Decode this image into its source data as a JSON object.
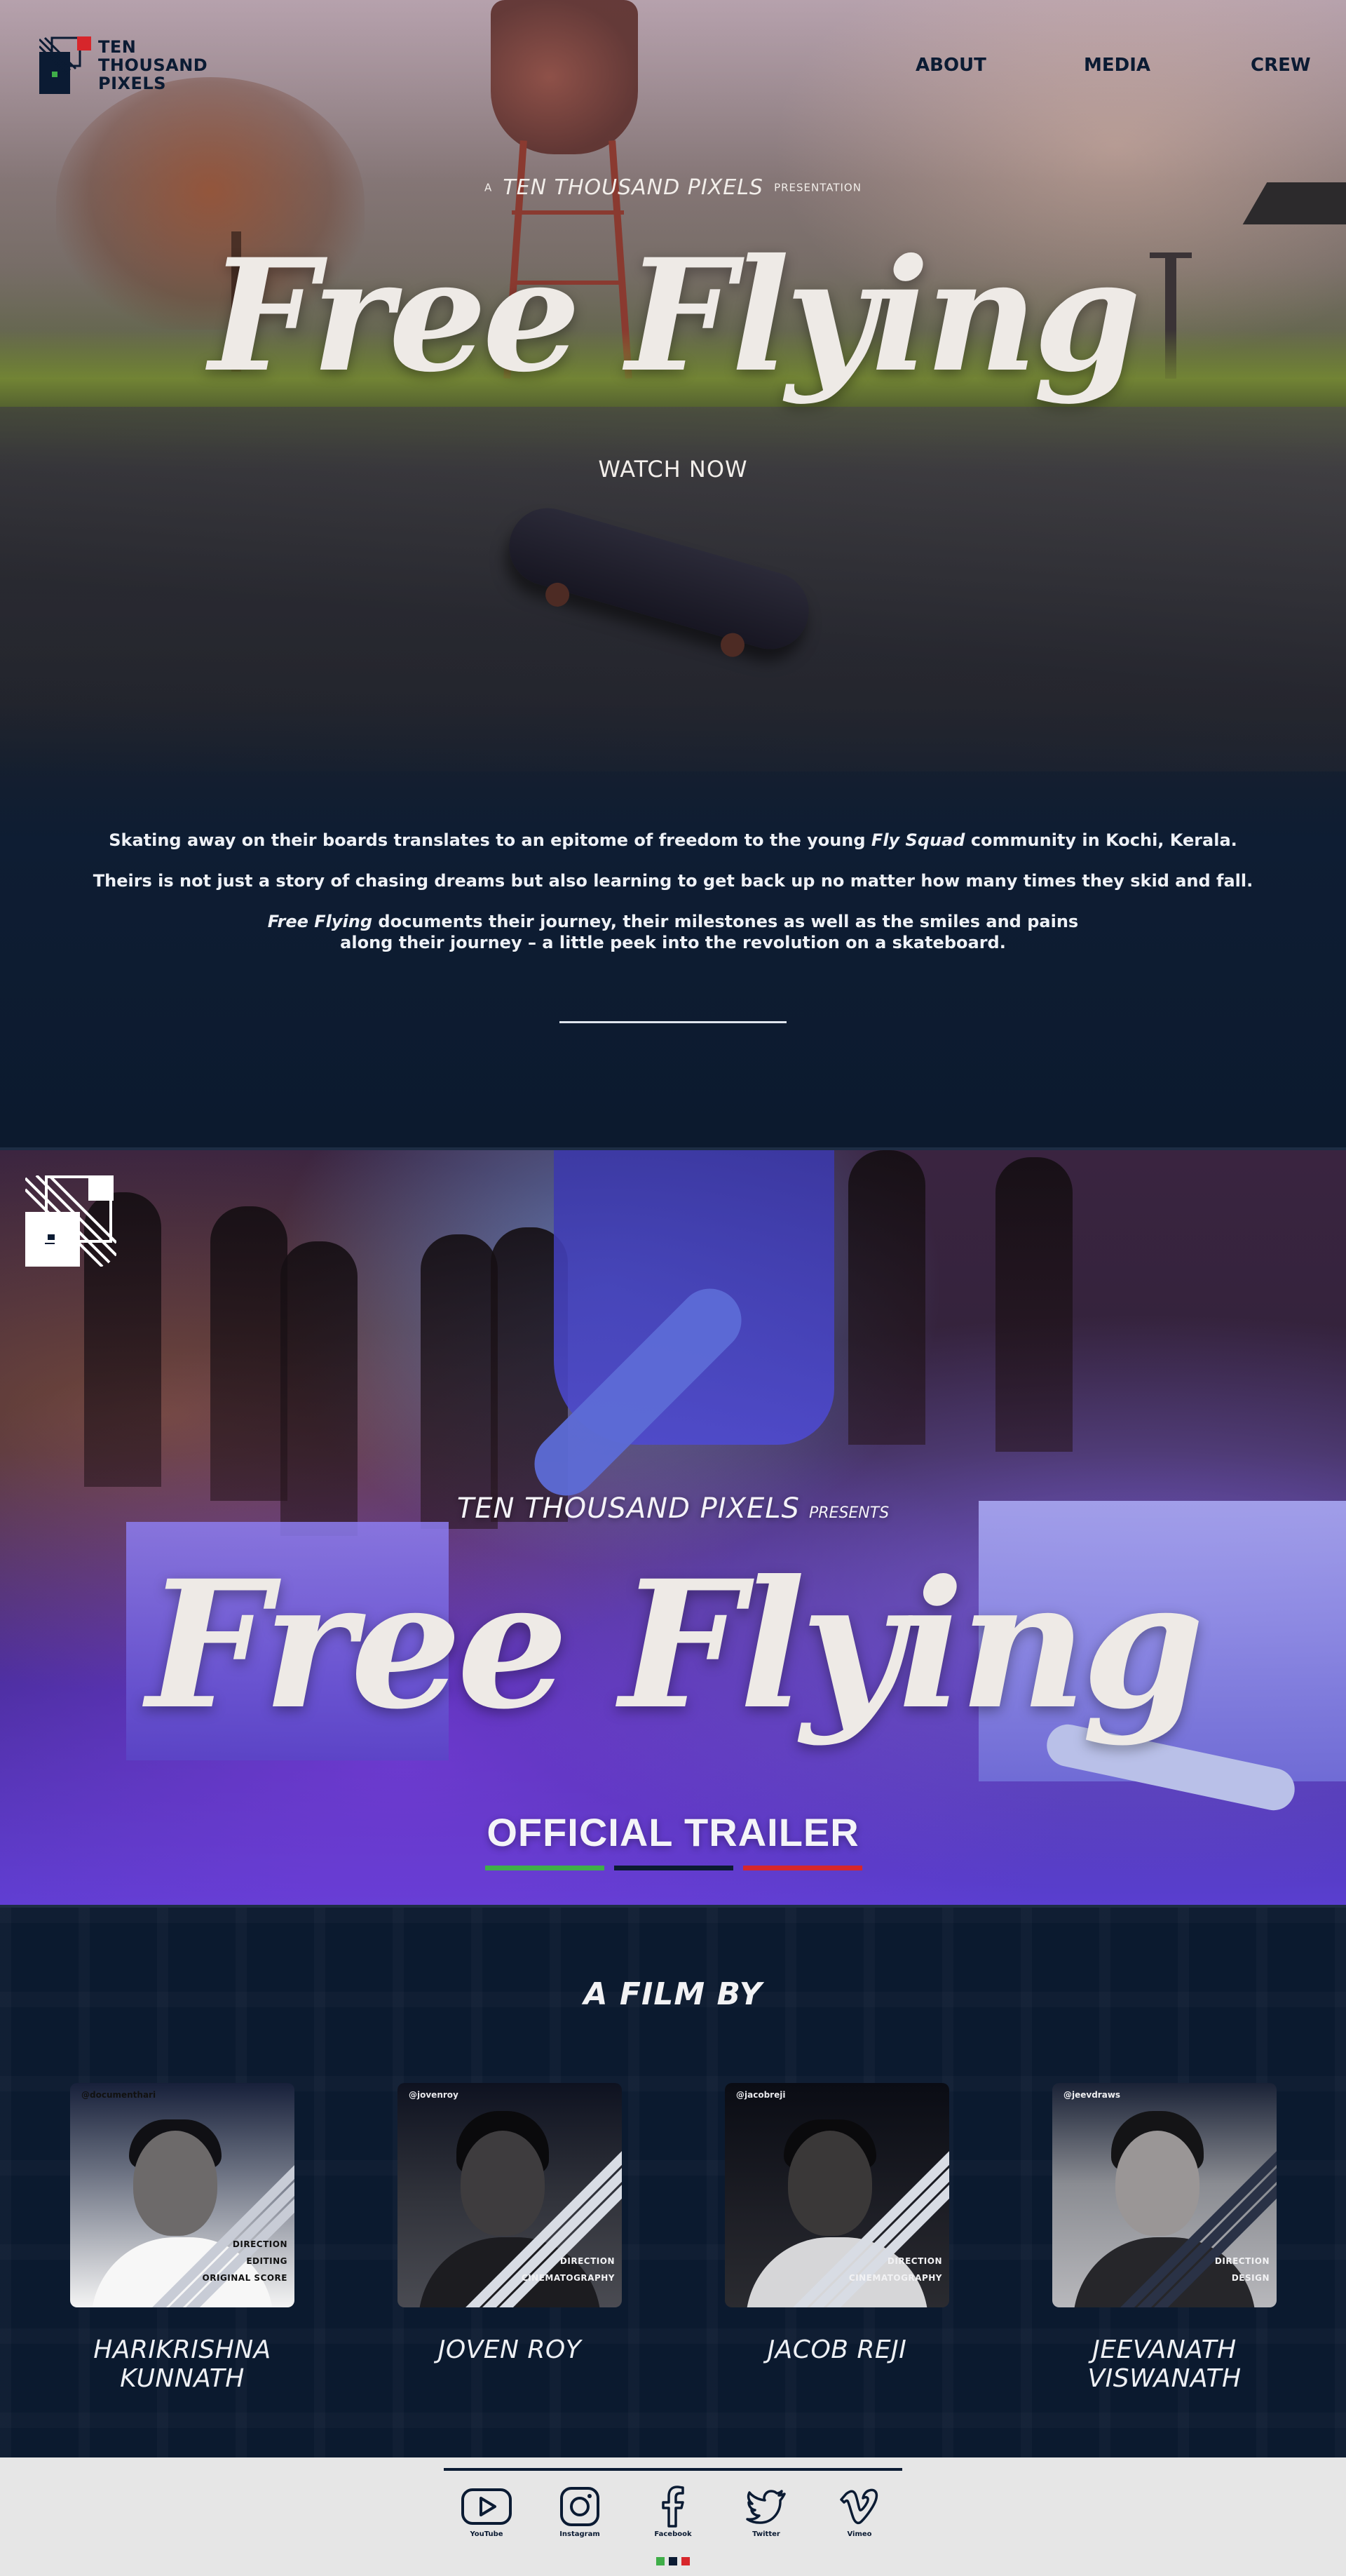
{
  "brand": {
    "logo_lines": [
      "TEN",
      "THOUSAND",
      "PIXELS"
    ],
    "colors": {
      "navy": "#0b1b33",
      "red": "#d7262b",
      "green": "#3fae49",
      "accent_white": "#ffffff"
    }
  },
  "nav": {
    "about": "ABOUT",
    "media": "MEDIA",
    "crew": "CREW"
  },
  "hero": {
    "presentation_prefix": "A",
    "presentation_brand": "TEN THOUSAND PIXELS",
    "presentation_suffix": "PRESENTATION",
    "title": "Free Flying",
    "watch_now": "WATCH NOW",
    "synopsis": {
      "p1_before": "Skating away on their boards translates to an epitome of freedom to the young ",
      "p1_em": "Fly Squad",
      "p1_after": " community in Kochi, Kerala.",
      "p2": "Theirs is not just a story of chasing dreams but also learning to get back up no matter how many times they skid and fall.",
      "p3_em": "Free Flying",
      "p3_after": " documents their journey, their milestones as well as the smiles and pains",
      "p4": "along their journey – a little peek into the revolution on a skateboard."
    }
  },
  "trailer": {
    "presents_brand": "TEN THOUSAND PIXELS",
    "presents_word": "PRESENTS",
    "title": "Free Flying",
    "subtitle": "OFFICIAL TRAILER",
    "stripe_colors": [
      "#3fae49",
      "#0b1b33",
      "#d7262b"
    ]
  },
  "film_by": {
    "heading": "A FILM BY",
    "crew": [
      {
        "handle": "@documenthari",
        "roles": [
          "DIRECTION",
          "EDITING",
          "ORIGINAL SCORE"
        ],
        "name": "HARIKRISHNA KUNNATH"
      },
      {
        "handle": "@jovenroy",
        "roles": [
          "DIRECTION",
          "CINEMATOGRAPHY"
        ],
        "name": "JOVEN ROY"
      },
      {
        "handle": "@jacobreji",
        "roles": [
          "DIRECTION",
          "CINEMATOGRAPHY"
        ],
        "name": "JACOB REJI"
      },
      {
        "handle": "@jeevdraws",
        "roles": [
          "DIRECTION",
          "DESIGN"
        ],
        "name": "JEEVANATH VISWANATH"
      }
    ]
  },
  "footer": {
    "social": [
      {
        "icon": "youtube-icon",
        "label": "YouTube"
      },
      {
        "icon": "instagram-icon",
        "label": "Instagram"
      },
      {
        "icon": "facebook-icon",
        "label": "Facebook"
      },
      {
        "icon": "twitter-icon",
        "label": "Twitter"
      },
      {
        "icon": "vimeo-icon",
        "label": "Vimeo"
      }
    ],
    "dot_colors": [
      "#3fae49",
      "#0b1b33",
      "#d7262b"
    ]
  }
}
